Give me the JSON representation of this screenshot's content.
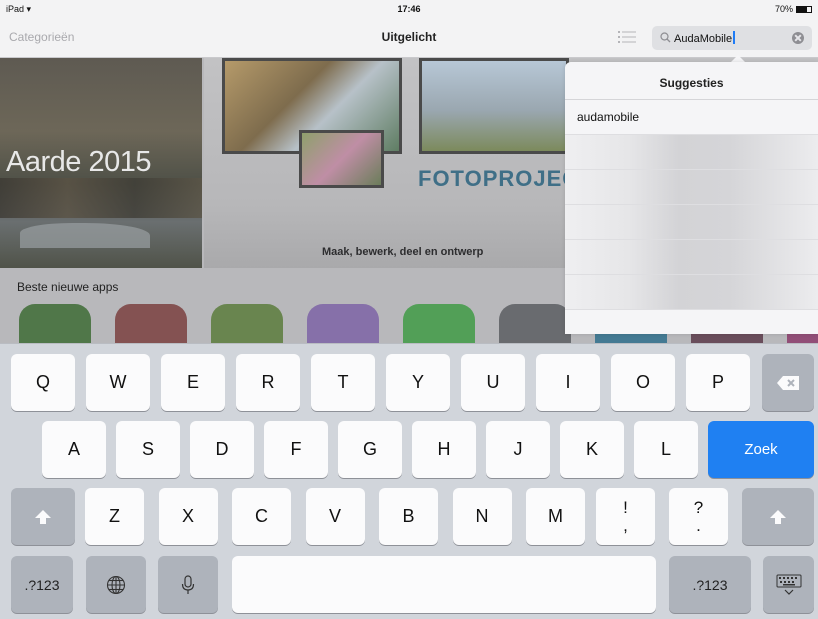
{
  "status_bar": {
    "device": "iPad",
    "time": "17:46",
    "battery": "70%",
    "battery_level": 0.7
  },
  "nav": {
    "left_label": "Categorieën",
    "title": "Uitgelicht"
  },
  "search": {
    "value": "AudaMobile"
  },
  "featured": {
    "nature_title": "Aarde 2015",
    "foto_title": "FOTOPROJEC",
    "foto_subtitle": "Maak, bewerk, deel en ontwerp"
  },
  "section": {
    "title": "Beste nieuwe apps"
  },
  "app_icons": [
    "#3d6b35",
    "#7a3f3f",
    "#5a7b3c",
    "#7d63a6",
    "#3f9a45",
    "#5b5d61",
    "#2f6e8c",
    "#5a3a4a",
    "#8a3b6b"
  ],
  "suggestions": {
    "title": "Suggesties",
    "items": [
      "audamobile"
    ]
  },
  "keyboard": {
    "row1": [
      "Q",
      "W",
      "E",
      "R",
      "T",
      "Y",
      "U",
      "I",
      "O",
      "P"
    ],
    "row2": [
      "A",
      "S",
      "D",
      "F",
      "G",
      "H",
      "J",
      "K",
      "L"
    ],
    "row3": [
      "Z",
      "X",
      "C",
      "V",
      "B",
      "N",
      "M"
    ],
    "punct1": {
      "top": "!",
      "bottom": ","
    },
    "punct2": {
      "top": "?",
      "bottom": "."
    },
    "search_key": "Zoek",
    "numbers_key": ".?123",
    "colors": {
      "search_key": "#1f80f2",
      "keyboard_bg": "#d1d5db"
    }
  }
}
